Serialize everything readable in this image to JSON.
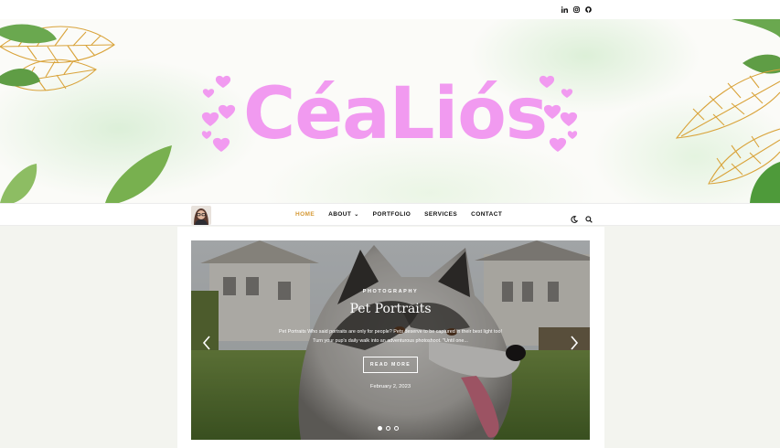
{
  "social": [
    {
      "icon": "linkedin-icon"
    },
    {
      "icon": "instagram-icon"
    },
    {
      "icon": "github-icon"
    }
  ],
  "brand": {
    "logo_text": "CéaLiós"
  },
  "nav": {
    "items": [
      {
        "label": "HOME",
        "active": true
      },
      {
        "label": "ABOUT",
        "has_dropdown": true
      },
      {
        "label": "PORTFOLIO"
      },
      {
        "label": "SERVICES"
      },
      {
        "label": "CONTACT"
      }
    ],
    "icons": [
      "moon-icon",
      "search-icon"
    ]
  },
  "slider": {
    "slide": {
      "category": "PHOTOGRAPHY",
      "title": "Pet Portraits",
      "excerpt_line1": "Pet Portraits Who said portraits are only for people? Pets deserve to be captured in their best light too!",
      "excerpt_line2": "Turn your pup's daily walk into an adventurous photoshoot. \"Until one...",
      "read_more": "READ MORE",
      "date": "February 2, 2023"
    },
    "dots_total": 3,
    "active_dot": 1
  },
  "colors": {
    "accent": "#d69a37",
    "logo_pink": "#f19af0",
    "page_bg": "#f3f4ef"
  }
}
